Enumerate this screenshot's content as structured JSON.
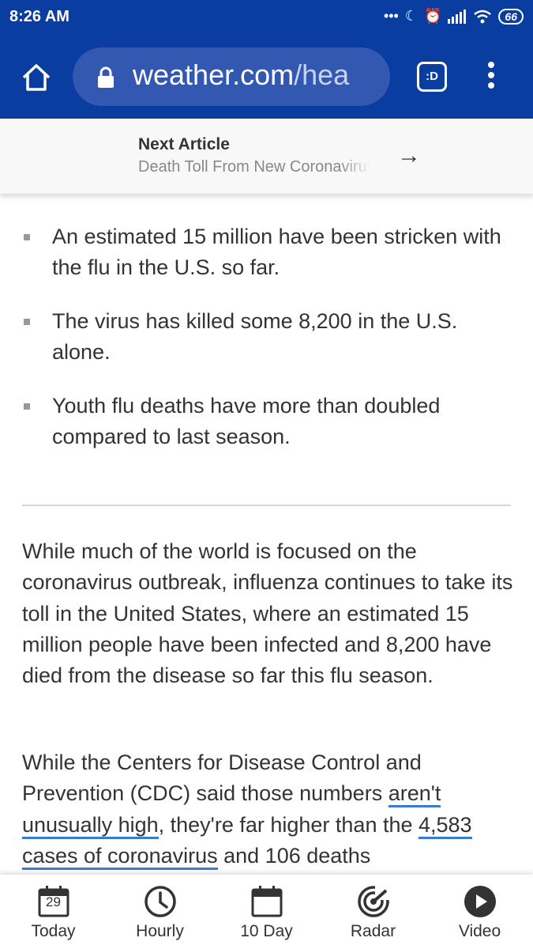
{
  "status_bar": {
    "time": "8:26 AM",
    "battery": "66"
  },
  "browser": {
    "url_domain": "weather.com",
    "url_path": "/hea",
    "tabs_label": ":D"
  },
  "next_article": {
    "heading": "Next Article",
    "title": "Death Toll From New Coronavirus",
    "arrow": "→"
  },
  "bullets": [
    "An estimated 15 million have been stricken with the flu in the U.S. so far.",
    "The virus has killed some 8,200 in the U.S. alone.",
    "Youth flu deaths have more than doubled compared to last season."
  ],
  "paragraph1": "While much of the world is focused on the coronavirus outbreak, influenza continues to take its toll in the United States, where an estimated 15 million people have been infected and 8,200 have died from the disease so far this flu season.",
  "paragraph2": {
    "part1": "While the Centers for Disease Control and Prevention (CDC) said those numbers ",
    "link1": "aren't unusually high",
    "part2": ", they're far higher than the ",
    "link2": "4,583 cases of coronavirus",
    "part3": " and 106 deaths"
  },
  "bottom_nav": {
    "calendar_day": "29",
    "items": [
      "Today",
      "Hourly",
      "10 Day",
      "Radar",
      "Video"
    ]
  },
  "colors": {
    "brand": "#0a3da0",
    "link_underline": "#3b7ad2"
  }
}
